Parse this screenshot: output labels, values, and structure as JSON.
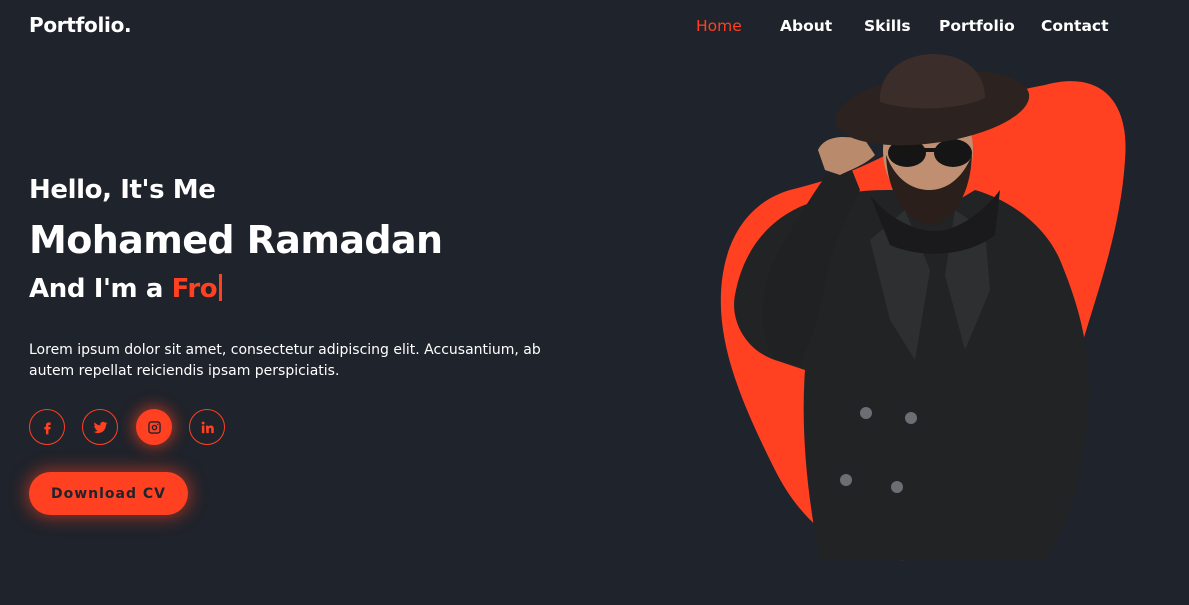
{
  "header": {
    "logo": "Portfolio.",
    "nav": [
      {
        "label": "Home",
        "active": true
      },
      {
        "label": "About",
        "active": false
      },
      {
        "label": "Skills",
        "active": false
      },
      {
        "label": "Portfolio",
        "active": false
      },
      {
        "label": "Contact",
        "active": false
      }
    ]
  },
  "hero": {
    "greeting": "Hello, It's Me",
    "name": "Mohamed Ramadan",
    "role_prefix": "And I'm a ",
    "role_typed": "Fro",
    "description": "Lorem ipsum dolor sit amet, consectetur adipiscing elit. Accusantium, ab autem repellat reiciendis ipsam perspiciatis.",
    "socials": [
      {
        "icon": "facebook-icon",
        "active": false
      },
      {
        "icon": "twitter-icon",
        "active": false
      },
      {
        "icon": "instagram-icon",
        "active": true
      },
      {
        "icon": "linkedin-icon",
        "active": false
      }
    ],
    "cta_label": "Download CV"
  },
  "colors": {
    "background": "#1f232b",
    "accent": "#ff4121",
    "text": "#ffffff"
  }
}
